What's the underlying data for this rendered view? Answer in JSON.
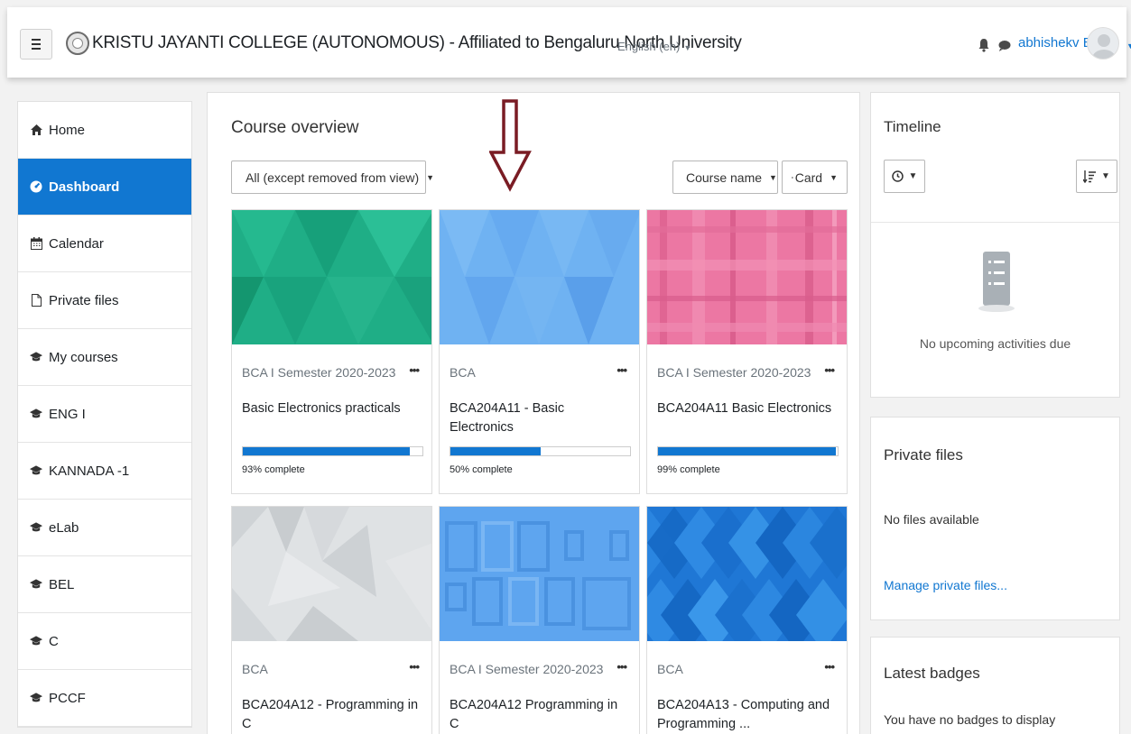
{
  "header": {
    "title": "KRISTU JAYANTI COLLEGE (AUTONOMOUS) - Affiliated to Bengaluru North University",
    "language": "English (en)",
    "username": "abhishekv BCA"
  },
  "sidebar": {
    "items": [
      {
        "label": "Home",
        "icon": "home-icon"
      },
      {
        "label": "Dashboard",
        "icon": "dashboard-icon"
      },
      {
        "label": "Calendar",
        "icon": "calendar-icon"
      },
      {
        "label": "Private files",
        "icon": "file-icon"
      },
      {
        "label": "My courses",
        "icon": "graduation-cap-icon"
      },
      {
        "label": "ENG I",
        "icon": "graduation-cap-icon"
      },
      {
        "label": "KANNADA -1",
        "icon": "graduation-cap-icon"
      },
      {
        "label": "eLab",
        "icon": "graduation-cap-icon"
      },
      {
        "label": "BEL",
        "icon": "graduation-cap-icon"
      },
      {
        "label": "C",
        "icon": "graduation-cap-icon"
      },
      {
        "label": "PCCF",
        "icon": "graduation-cap-icon"
      }
    ]
  },
  "overview": {
    "title": "Course overview",
    "filter_label": "All (except removed from view)",
    "sort_label": "Course name",
    "view_label": "Card"
  },
  "courses": [
    {
      "category": "BCA I Semester 2020-2023",
      "name": "Basic Electronics practicals",
      "progress": 0.93,
      "progress_label": "93% complete",
      "color": "#1fae86"
    },
    {
      "category": "BCA",
      "name": "BCA204A11 - Basic Electronics",
      "progress": 0.5,
      "progress_label": "50% complete",
      "color": "#6fb2f2"
    },
    {
      "category": "BCA I Semester 2020-2023",
      "name": "BCA204A11 Basic Electronics",
      "progress": 0.99,
      "progress_label": "99% complete",
      "color": "#ec77a3"
    },
    {
      "category": "BCA",
      "name": "BCA204A12 - Programming in C",
      "color": "#dfe2e4"
    },
    {
      "category": "BCA I Semester 2020-2023",
      "name": "BCA204A12 Programming in C",
      "color": "#5ea5ef"
    },
    {
      "category": "BCA",
      "name": "BCA204A13 - Computing and Programming ...",
      "color": "#1f77d5"
    }
  ],
  "timeline": {
    "title": "Timeline",
    "empty_text": "No upcoming activities due"
  },
  "private_files": {
    "title": "Private files",
    "empty_text": "No files available",
    "manage_link": "Manage private files..."
  },
  "badges": {
    "title": "Latest badges",
    "empty_text": "You have no badges to display"
  },
  "colors": {
    "accent": "#1177d1",
    "annotation_arrow": "#7a1c24"
  }
}
